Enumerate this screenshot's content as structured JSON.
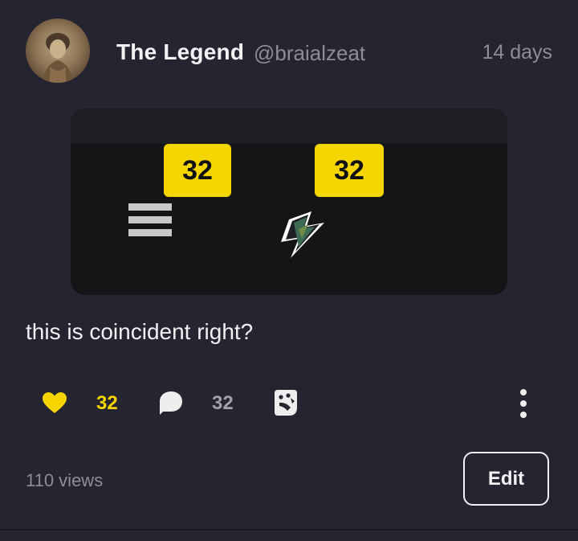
{
  "post": {
    "author": {
      "name": "The Legend",
      "handle": "@braialzeat"
    },
    "time": "14 days",
    "caption": "this is coincident right?",
    "embed": {
      "badges": [
        "32",
        "32"
      ],
      "icons": [
        "menu-icon",
        "lightning-bolt-icon"
      ],
      "badge_color": "#f4d500"
    },
    "actions": {
      "likes": "32",
      "comments": "32",
      "liked": true,
      "like_color": "#f5d400"
    },
    "views": "110 views",
    "edit_label": "Edit"
  }
}
